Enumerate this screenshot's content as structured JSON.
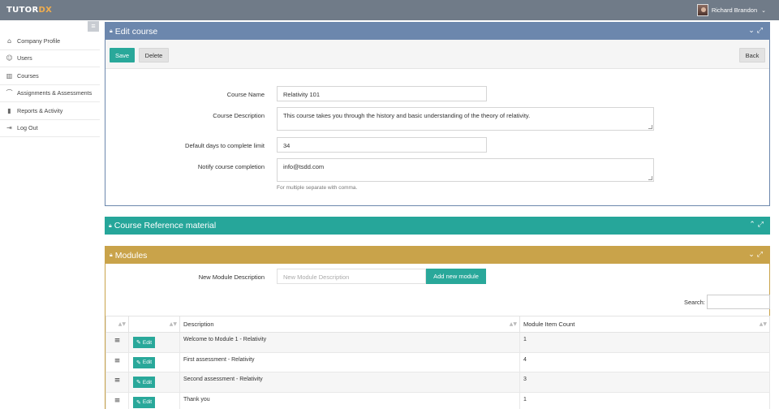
{
  "app": {
    "logo_main": "TUTOR",
    "logo_accent": "DX",
    "user_name": "Richard Brandon"
  },
  "sidebar": {
    "items": [
      {
        "label": "Company Profile",
        "icon": "building-icon"
      },
      {
        "label": "Users",
        "icon": "users-icon"
      },
      {
        "label": "Courses",
        "icon": "book-icon"
      },
      {
        "label": "Assignments & Assessments",
        "icon": "graduation-cap-icon"
      },
      {
        "label": "Reports & Activity",
        "icon": "bar-chart-icon"
      },
      {
        "label": "Log Out",
        "icon": "logout-icon"
      }
    ]
  },
  "edit_course": {
    "title": "Edit course",
    "save_label": "Save",
    "delete_label": "Delete",
    "back_label": "Back",
    "course_name_label": "Course Name",
    "course_name_value": "Relativity 101",
    "description_label": "Course Description",
    "description_value": "This course takes you through the history and basic understanding of the theory of relativity.",
    "days_label": "Default days to complete limit",
    "days_value": "34",
    "notify_label": "Notify course completion",
    "notify_value": "info@tsdd.com",
    "notify_help": "For multiple separate with comma."
  },
  "reference": {
    "title": "Course Reference material"
  },
  "modules": {
    "title": "Modules",
    "new_label": "New Module Description",
    "new_placeholder": "New Module Description",
    "add_label": "Add new module",
    "search_label": "Search:",
    "columns": [
      "",
      "",
      "Description",
      "Module Item Count"
    ],
    "edit_label": "Edit",
    "rows": [
      {
        "description": "Welcome to Module 1 - Relativity",
        "count": "1"
      },
      {
        "description": "First assessment - Relativity",
        "count": "4"
      },
      {
        "description": "Second assessment - Relativity",
        "count": "3"
      },
      {
        "description": "Thank you",
        "count": "1"
      }
    ]
  },
  "colors": {
    "topbar": "#707b88",
    "edit_header": "#6c87ad",
    "teal": "#26a69a",
    "gold": "#c9a34a"
  }
}
